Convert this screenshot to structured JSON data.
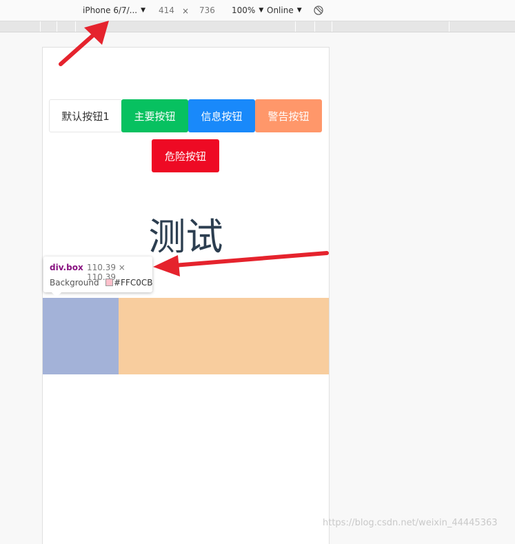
{
  "toolbar": {
    "device": "iPhone 6/7/...",
    "width": "414",
    "times": "×",
    "height": "736",
    "zoom": "100%",
    "network": "Online"
  },
  "buttons": {
    "default": "默认按钮1",
    "primary": "主要按钮",
    "info": "信息按钮",
    "warning": "警告按钮",
    "danger": "危险按钮"
  },
  "heading": "测试",
  "tooltip": {
    "element": "div.box",
    "size": "110.39 × 110.39",
    "background_label": "Background",
    "background_value": "#FFC0CB"
  },
  "colors": {
    "primary": "#07c160",
    "info": "#1989fa",
    "warning": "#ff976a",
    "danger": "#ee0a24",
    "box_left": "#a3b2d8",
    "box_right": "#f8cd9e",
    "swatch": "#FFC0CB",
    "annotation_arrow": "#e5232d"
  },
  "watermark": "https://blog.csdn.net/weixin_44445363"
}
